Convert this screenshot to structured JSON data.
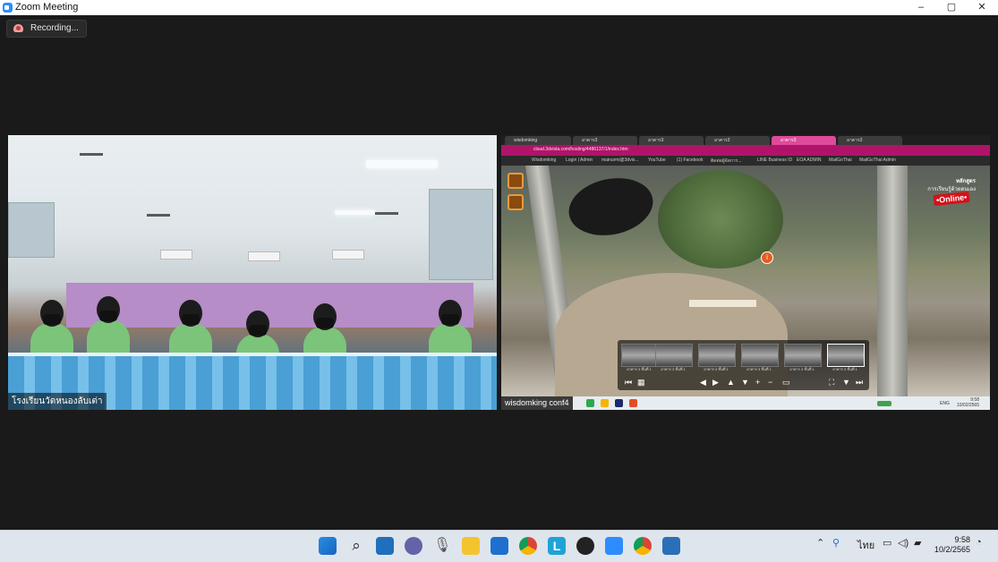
{
  "window": {
    "title": "Zoom Meeting",
    "minimize": "–",
    "maximize": "▢",
    "close": "✕"
  },
  "recording": {
    "label": "Recording..."
  },
  "participants": [
    {
      "name": "โรงเรียนวัดหนองลับเต่า"
    },
    {
      "name": "wisdomking conf4"
    }
  ],
  "shared_browser": {
    "tabs": [
      "wisdomking",
      "อาคาร3",
      "อาคาร3",
      "อาคาร3",
      "อาคาร3",
      "อาคาร3"
    ],
    "url": "cloud.3dvista.com/hosting/4486137/1/index.htm",
    "bookmarks": [
      "Wisdomking",
      "Login | Admin",
      "mainurmi@3dvis...",
      "YouTube",
      "(1) Facebook",
      "ติดต่อผู้จัดการ...",
      "LINE Business ID",
      "EOA ADMIN",
      "MailGoThai",
      "MailGoThai Admin"
    ],
    "online_badge": {
      "line1": "หลักสูตร",
      "line2": "การเรียนรู้ด้วยตนเอง",
      "pill": "•Online•"
    },
    "thumb_labels": [
      "อาคาร 3 ชั้นที่ 1",
      "อาคาร 3 ชั้นที่ 1",
      "อาคาร 3 ชั้นที่ 1",
      "อาคาร 3 ชั้นที่ 1",
      "อาคาร 3 ชั้นที่ 1",
      "อาคาร 3 ชั้นที่ 1"
    ],
    "inner_clock": {
      "time": "9:58",
      "date": "10/02/2565"
    },
    "inner_lang": "ENG"
  },
  "taskbar": {
    "lang": "ไทย",
    "time": "9:58",
    "date": "10/2/2565"
  }
}
